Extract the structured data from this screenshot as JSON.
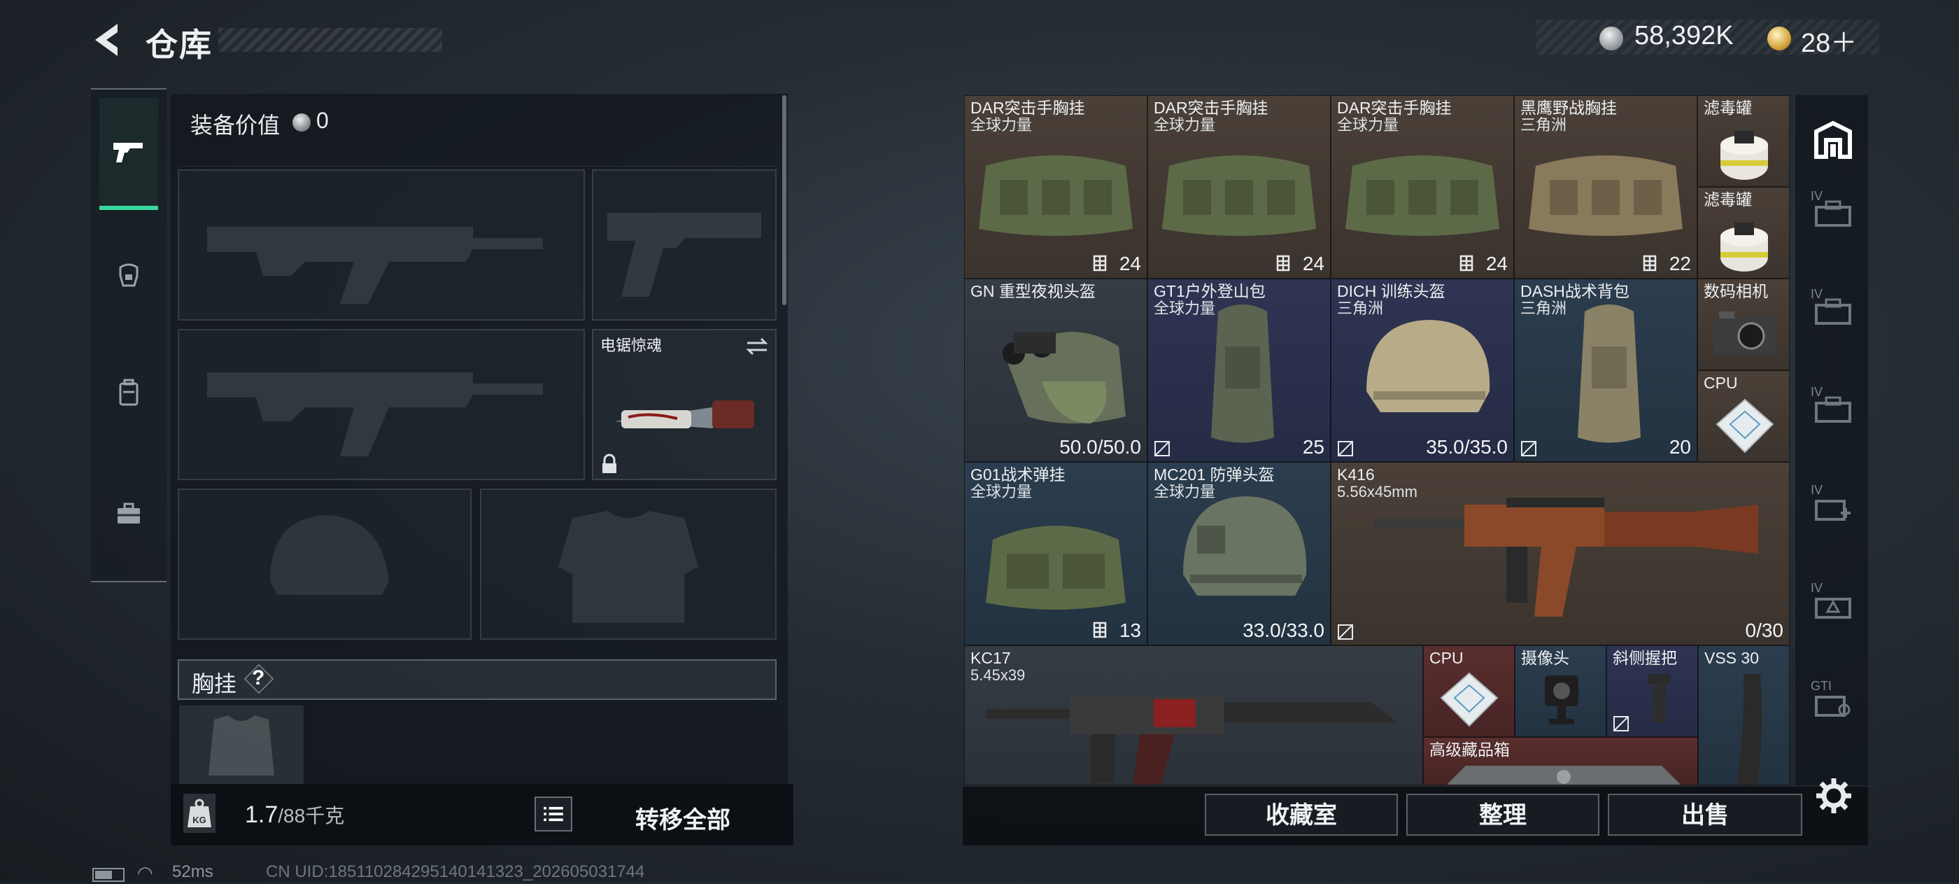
{
  "header": {
    "title": "仓库",
    "currency_main": "58,392K",
    "currency_premium": "28＋"
  },
  "equipment": {
    "value_label": "装备价值",
    "value": "0",
    "melee_name": "电锯惊魂",
    "chest_label": "胸挂",
    "chest_help": "?"
  },
  "footer_left": {
    "weight": "1.7",
    "weight_max": "/88千克",
    "transfer_all": "转移全部"
  },
  "status": {
    "ping": "52ms",
    "uid": "CN UID:185110284295140141323_202605031744"
  },
  "storage": {
    "items": [
      {
        "name": "DAR突击手胸挂",
        "sub": "全球力量",
        "value": "24"
      },
      {
        "name": "DAR突击手胸挂",
        "sub": "全球力量",
        "value": "24"
      },
      {
        "name": "DAR突击手胸挂",
        "sub": "全球力量",
        "value": "24"
      },
      {
        "name": "黑鹰野战胸挂",
        "sub": "三角洲",
        "value": "22"
      },
      {
        "name": "滤毒罐"
      },
      {
        "name": "滤毒罐"
      },
      {
        "name": "GN 重型夜视头盔",
        "value": "50.0/50.0"
      },
      {
        "name": "GT1户外登山包",
        "sub": "全球力量",
        "value": "25"
      },
      {
        "name": "DICH 训练头盔",
        "sub": "三角洲",
        "value": "35.0/35.0"
      },
      {
        "name": "DASH战术背包",
        "sub": "三角洲",
        "value": "20"
      },
      {
        "name": "数码相机"
      },
      {
        "name": "CPU"
      },
      {
        "name": "G01战术弹挂",
        "sub": "全球力量",
        "value": "13"
      },
      {
        "name": "MC201 防弹头盔",
        "sub": "全球力量",
        "value": "33.0/33.0"
      },
      {
        "name": "K416",
        "sub": "5.56x45mm",
        "value": "0/30"
      },
      {
        "name": "KC17",
        "sub": "5.45x39"
      },
      {
        "name": "CPU"
      },
      {
        "name": "摄像头"
      },
      {
        "name": "斜侧握把"
      },
      {
        "name": "VSS 30"
      },
      {
        "name": "高级藏品箱"
      }
    ]
  },
  "actions": {
    "collection": "收藏室",
    "sort": "整理",
    "sell": "出售"
  },
  "sidebar": {
    "tabs": [
      "IV",
      "IV",
      "IV",
      "IV",
      "IV",
      "GTI"
    ]
  }
}
